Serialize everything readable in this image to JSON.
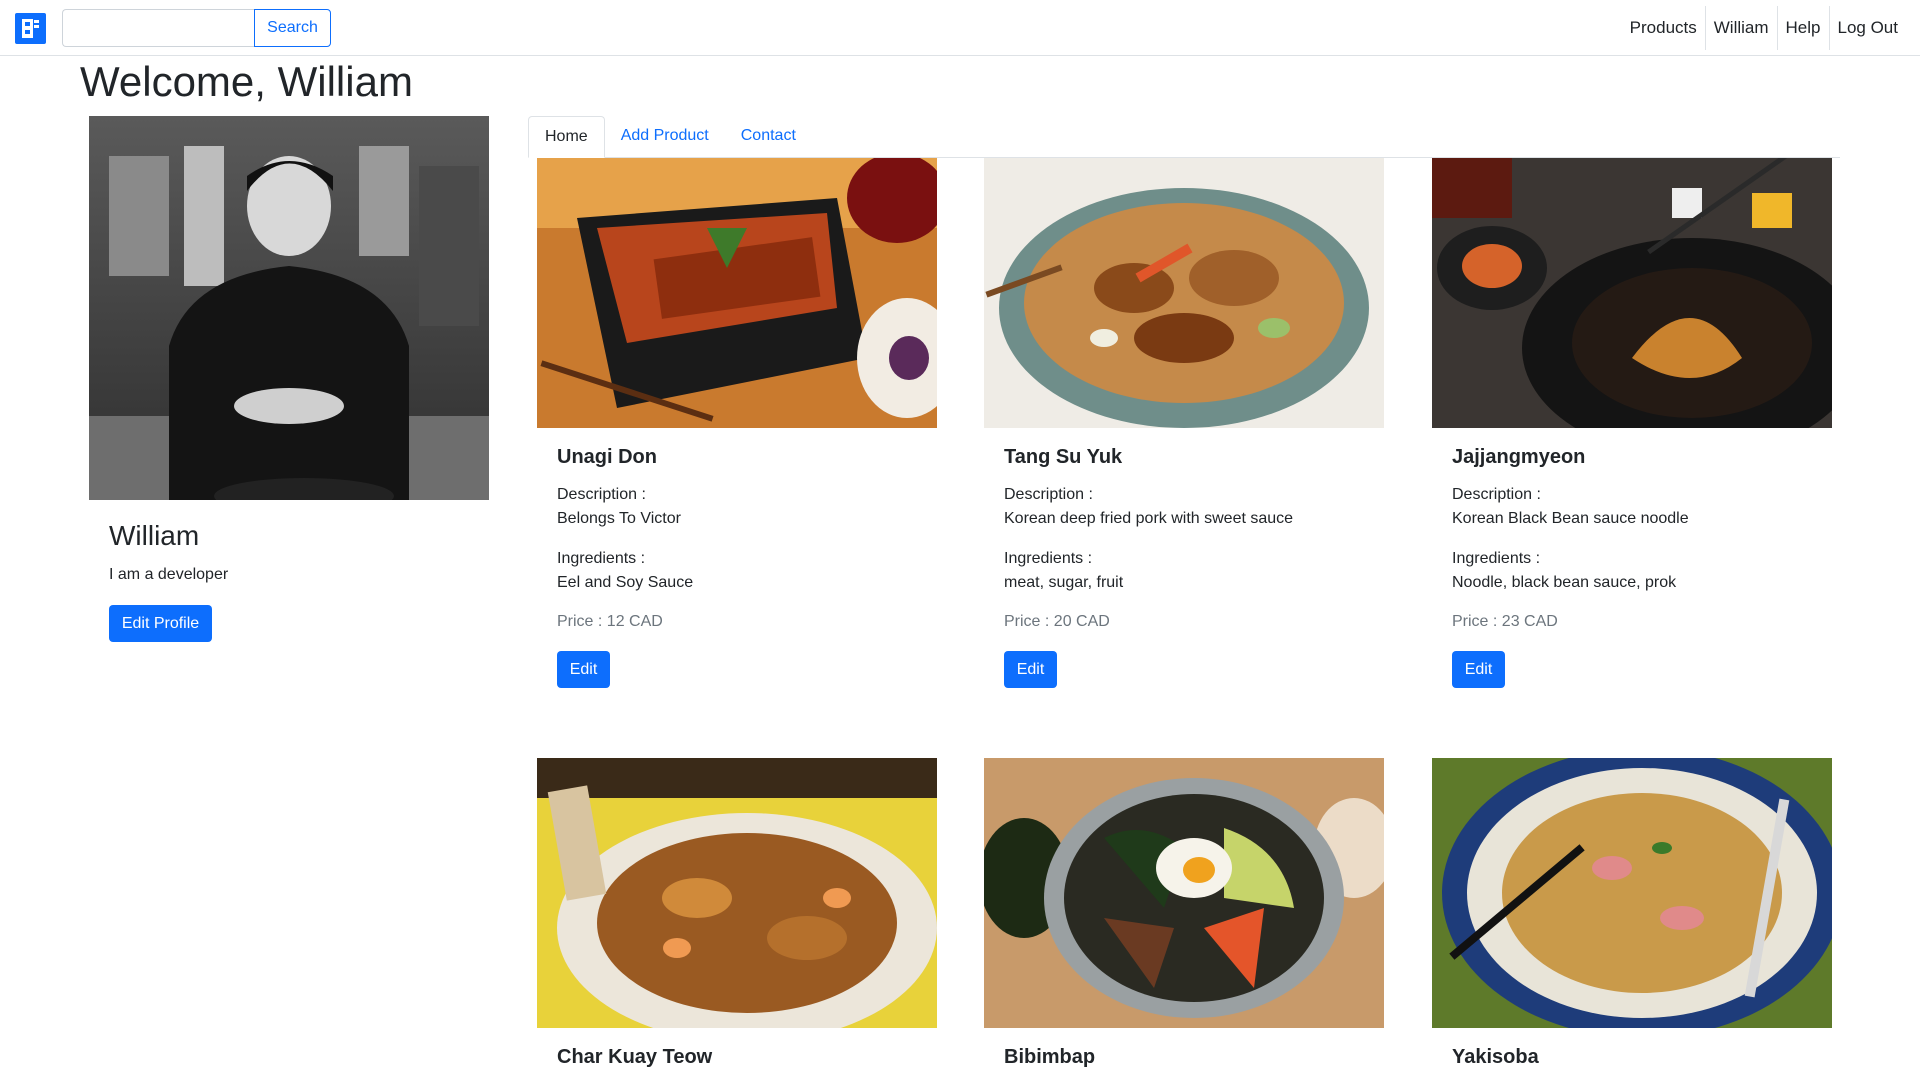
{
  "colors": {
    "accent": "#0d6efd",
    "border": "#dee2e6",
    "muted": "#6c757d",
    "text": "#212529"
  },
  "navbar": {
    "logo_icon": "brand-logo-icon",
    "search": {
      "value": "",
      "placeholder": "",
      "button_label": "Search"
    },
    "links": [
      "Products",
      "William",
      "Help",
      "Log Out"
    ]
  },
  "welcome": "Welcome, William",
  "profile": {
    "name": "William",
    "bio": "I am a developer",
    "edit_label": "Edit Profile"
  },
  "tabs": [
    {
      "label": "Home",
      "active": true
    },
    {
      "label": "Add Product",
      "active": false
    },
    {
      "label": "Contact",
      "active": false
    }
  ],
  "products": [
    {
      "name": "Unagi Don",
      "description_label": "Description :",
      "description": "Belongs To Victor",
      "ingredients_label": "Ingredients :",
      "ingredients": "Eel and Soy Sauce",
      "price": "Price : 12 CAD",
      "edit_label": "Edit"
    },
    {
      "name": "Tang Su Yuk",
      "description_label": "Description :",
      "description": "Korean deep fried pork with sweet sauce",
      "ingredients_label": "Ingredients :",
      "ingredients": "meat, sugar, fruit",
      "price": "Price : 20 CAD",
      "edit_label": "Edit"
    },
    {
      "name": "Jajjangmyeon",
      "description_label": "Description :",
      "description": "Korean Black Bean sauce noodle",
      "ingredients_label": "Ingredients :",
      "ingredients": "Noodle, black bean sauce, prok",
      "price": "Price : 23 CAD",
      "edit_label": "Edit"
    },
    {
      "name": "Char Kuay Teow"
    },
    {
      "name": "Bibimbap"
    },
    {
      "name": "Yakisoba"
    }
  ]
}
